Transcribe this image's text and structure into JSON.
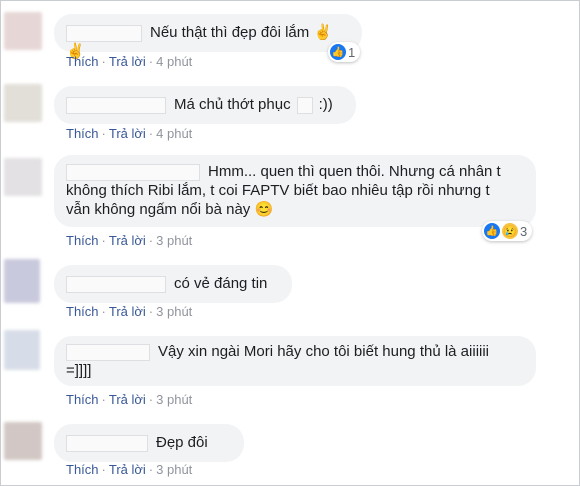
{
  "colors": {
    "link": "#385898",
    "bubble": "#f2f3f5",
    "meta": "#90949c",
    "like": "#1877f2"
  },
  "comments": [
    {
      "text": "Nếu thật thì đẹp đôi lắm",
      "emoji": "✌✌",
      "like": "Thích",
      "reply": "Trả lời",
      "time": "4 phút",
      "reaction_count": "1",
      "avatar_color": "#e6d7d6"
    },
    {
      "text": "Má chủ thớt phục",
      "tail": ":))",
      "like": "Thích",
      "reply": "Trả lời",
      "time": "4 phút",
      "avatar_color": "#e2ded8"
    },
    {
      "lines": [
        "Hmm... quen thì quen thôi. Nhưng cá nhân t",
        "không thích Ribi lắm, t coi FAPTV biết bao nhiêu tập rồi nhưng t",
        "vẫn không ngấm nổi bà này"
      ],
      "emoji": "😊",
      "like": "Thích",
      "reply": "Trả lời",
      "time": "3 phút",
      "reaction_count": "3",
      "avatar_color": "#e3e1e3"
    },
    {
      "text": "có vẻ đáng tin",
      "like": "Thích",
      "reply": "Trả lời",
      "time": "3 phút",
      "avatar_color": "#c9c9dd"
    },
    {
      "lines": [
        "Vậy xin ngài Mori hãy cho tôi biết hung thủ là aiiiiii",
        "=]]]]"
      ],
      "like": "Thích",
      "reply": "Trả lời",
      "time": "3 phút",
      "avatar_color": "#d7dde8"
    },
    {
      "text": "Đẹp đôi",
      "like": "Thích",
      "reply": "Trả lời",
      "time": "3 phút",
      "avatar_color": "#d2c7c4"
    }
  ]
}
